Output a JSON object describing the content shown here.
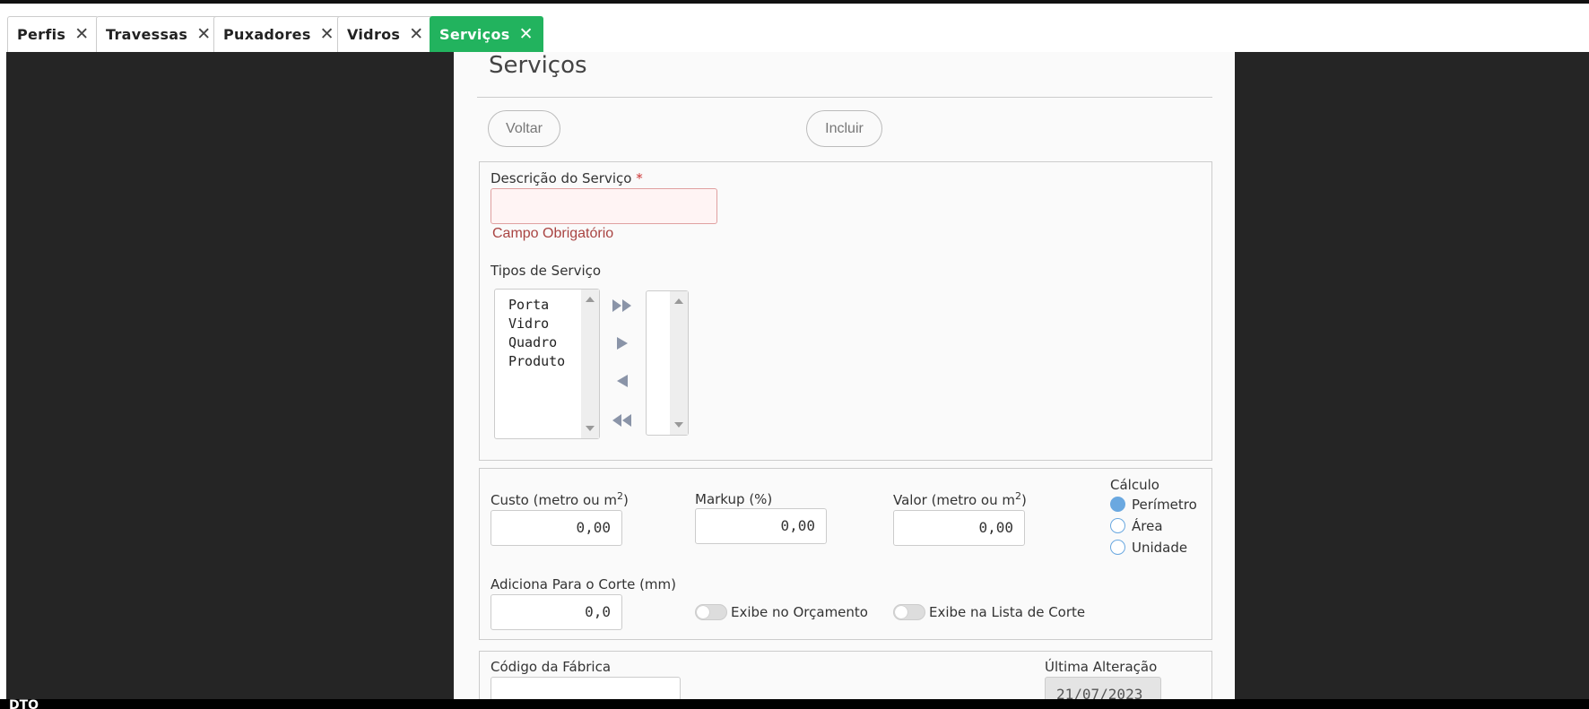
{
  "tabs": [
    {
      "label": "Perfis"
    },
    {
      "label": "Travessas"
    },
    {
      "label": "Puxadores"
    },
    {
      "label": "Vidros"
    },
    {
      "label": "Serviços",
      "active": true
    }
  ],
  "tab_close_glyph": "✕",
  "page": {
    "title": "Serviços"
  },
  "toolbar": {
    "back_label": "Voltar",
    "include_label": "Incluir"
  },
  "form": {
    "description": {
      "label": "Descrição do Serviço",
      "required_mark": "*",
      "value": "",
      "error": "Campo Obrigatório"
    },
    "service_types": {
      "label": "Tipos de Serviço",
      "available": [
        "Porta",
        "Vidro",
        "Quadro",
        "Produto"
      ],
      "selected": []
    },
    "cost": {
      "label": "Custo (metro ou m",
      "sup": "2",
      "label_end": ")",
      "value": "0,00"
    },
    "markup": {
      "label": "Markup (%)",
      "value": "0,00"
    },
    "price": {
      "label": "Valor (metro ou m",
      "sup": "2",
      "label_end": ")",
      "value": "0,00"
    },
    "calculation": {
      "label": "Cálculo",
      "options": [
        {
          "label": "Perímetro",
          "checked": true
        },
        {
          "label": "Área",
          "checked": false
        },
        {
          "label": "Unidade",
          "checked": false
        }
      ]
    },
    "cut_add": {
      "label": "Adiciona Para o Corte (mm)",
      "value": "0,0"
    },
    "show_budget": {
      "label": "Exibe no Orçamento",
      "on": false
    },
    "show_cut_list": {
      "label": "Exibe na Lista de Corte",
      "on": false
    },
    "factory_code": {
      "label": "Código da Fábrica",
      "value": ""
    },
    "last_change": {
      "label": "Última Alteração",
      "value": "21/07/2023"
    }
  },
  "status_bar": {
    "text": "DTO"
  },
  "colors": {
    "active_tab": "#22b35e",
    "radio": "#6aa8e0",
    "error": "#a94442"
  },
  "icons": [
    "close-icon",
    "move-all-right-icon",
    "move-right-icon",
    "move-left-icon",
    "move-all-left-icon"
  ]
}
